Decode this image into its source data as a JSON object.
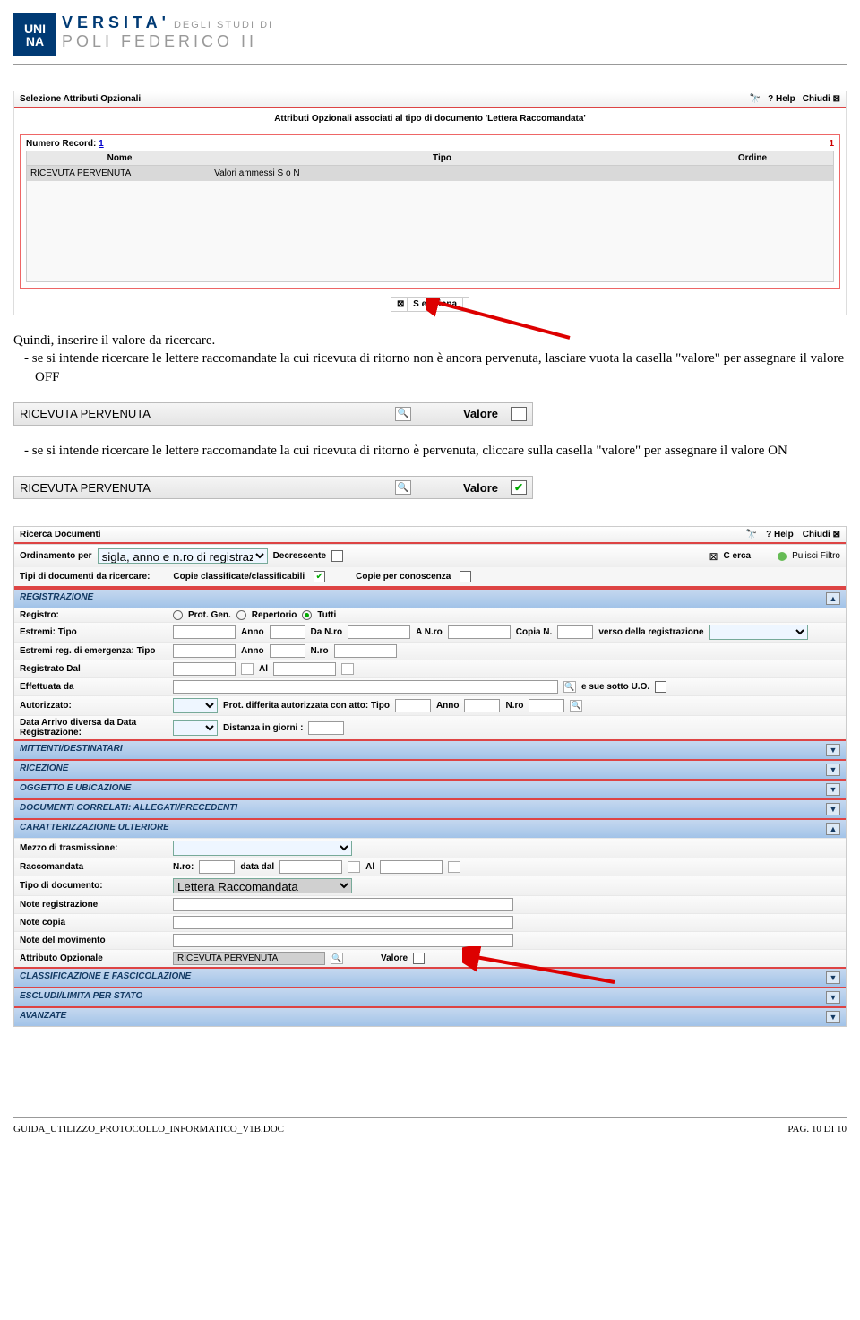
{
  "logo": {
    "box1": "UNI",
    "box2": "NA",
    "rest1": "VERSITA'",
    "rest1b": "DEGLI STUDI DI",
    "rest2": "POLI FEDERICO II"
  },
  "win1": {
    "title": "Selezione Attributi Opzionali",
    "help": "? Help",
    "close": "Chiudi ⊠",
    "subtitle": "Attributi Opzionali associati al tipo di documento 'Lettera Raccomandata'",
    "numrec_label": "Numero Record:",
    "numrec_val": "1",
    "page_ind": "1",
    "head_nome": "Nome",
    "head_tipo": "Tipo",
    "head_ordine": "Ordine",
    "row_nome": "RICEVUTA PERVENUTA",
    "row_tipo": "Valori ammessi S o N",
    "seleziona": "S eleziona"
  },
  "text1": "Quindi, inserire il valore da ricercare.",
  "bullet1": "se si intende ricercare le lettere raccomandate la cui ricevuta di ritorno non è ancora pervenuta, lasciare vuota la casella \"valore\" per assegnare il valore OFF",
  "crop1": {
    "label": "RICEVUTA PERVENUTA",
    "valore": "Valore"
  },
  "bullet2": "se si intende ricercare le lettere raccomandate la cui ricevuta di ritorno è pervenuta, cliccare sulla casella \"valore\" per assegnare il valore ON",
  "crop2": {
    "label": "RICEVUTA PERVENUTA",
    "valore": "Valore"
  },
  "win2": {
    "title": "Ricerca Documenti",
    "help": "? Help",
    "close": "Chiudi ⊠",
    "cerca": "C erca",
    "pulisci": "Pulisci Filtro",
    "ord_lbl": "Ordinamento per",
    "ord_val": "sigla, anno e n.ro di registrazione",
    "decrescente": "Decrescente",
    "tipi_lbl": "Tipi di documenti da ricercare:",
    "copie_class": "Copie classificate/classificabili",
    "copie_conos": "Copie per conoscenza",
    "sec_registrazione": "REGISTRAZIONE",
    "registro": "Registro:",
    "prot_gen": "Prot. Gen.",
    "repertorio": "Repertorio",
    "tutti": "Tutti",
    "estremi_tipo": "Estremi: Tipo",
    "anno": "Anno",
    "da_nro": "Da N.ro",
    "a_nro": "A N.ro",
    "copia_n": "Copia N.",
    "verso": "verso della registrazione",
    "estremi_emerg": "Estremi reg. di emergenza: Tipo",
    "nro": "N.ro",
    "registrato_dal": "Registrato Dal",
    "al": "Al",
    "effettuata_da": "Effettuata da",
    "e_sue": "e sue sotto U.O.",
    "autorizzato": "Autorizzato:",
    "prot_diff": "Prot. differita autorizzata con atto: Tipo",
    "data_arrivo": "Data Arrivo diversa da Data Registrazione:",
    "distanza": "Distanza in giorni :",
    "sec_mittenti": "MITTENTI/DESTINATARI",
    "sec_ricezione": "RICEZIONE",
    "sec_oggetto": "OGGETTO E UBICAZIONE",
    "sec_documenti": "DOCUMENTI CORRELATI: ALLEGATI/PRECEDENTI",
    "sec_caratt": "CARATTERIZZAZIONE ULTERIORE",
    "mezzo": "Mezzo di trasmissione:",
    "raccomandata": "Raccomandata",
    "nro2": "N.ro:",
    "data_dal": "data dal",
    "tipo_doc": "Tipo di documento:",
    "tipo_doc_val": "Lettera Raccomandata",
    "note_reg": "Note registrazione",
    "note_copia": "Note copia",
    "note_mov": "Note del movimento",
    "attr_opz": "Attributo Opzionale",
    "attr_val": "RICEVUTA PERVENUTA",
    "valore": "Valore",
    "sec_classif": "CLASSIFICAZIONE E FASCICOLAZIONE",
    "sec_escludi": "ESCLUDI/LIMITA PER STATO",
    "sec_avanzate": "AVANZATE"
  },
  "footer": {
    "left": "GUIDA_UTILIZZO_PROTOCOLLO_INFORMATICO_V1B.DOC",
    "right": "PAG. 10 DI 10"
  }
}
